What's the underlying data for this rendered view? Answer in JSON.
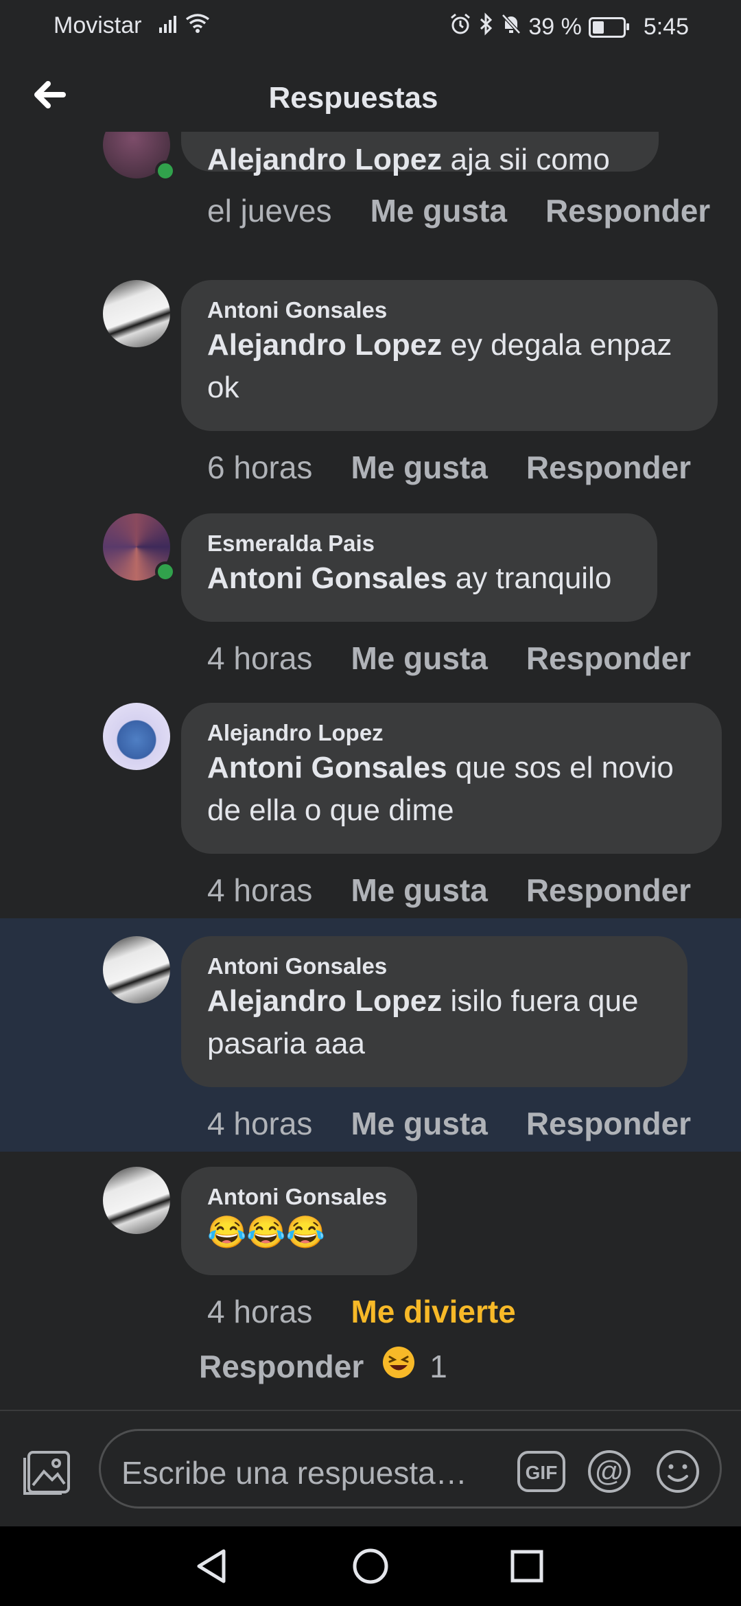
{
  "status": {
    "carrier": "Movistar",
    "battery": "39 %",
    "time": "5:45"
  },
  "header": {
    "title": "Respuestas"
  },
  "comments": [
    {
      "author": "",
      "mention": "Alejandro Lopez",
      "text": "aja sii como",
      "time": "el jueves",
      "like": "Me gusta",
      "reply": "Responder"
    },
    {
      "author": "Antoni Gonsales",
      "mention": "Alejandro Lopez",
      "text": "ey degala enpaz ok",
      "time": "6 horas",
      "like": "Me gusta",
      "reply": "Responder"
    },
    {
      "author": "Esmeralda Pais",
      "mention": "Antoni Gonsales",
      "text": "ay tranquilo",
      "time": "4 horas",
      "like": "Me gusta",
      "reply": "Responder"
    },
    {
      "author": "Alejandro Lopez",
      "mention": "Antoni Gonsales",
      "text": "que sos el novio de ella o que dime",
      "time": "4 horas",
      "like": "Me gusta",
      "reply": "Responder"
    },
    {
      "author": "Antoni Gonsales",
      "mention": "Alejandro Lopez",
      "text": "isilo fuera que pasaria aaa",
      "time": "4 horas",
      "like": "Me gusta",
      "reply": "Responder"
    },
    {
      "author": "Antoni Gonsales",
      "emoji": "😂😂😂",
      "time": "4 horas",
      "reaction": "Me divierte",
      "reply": "Responder",
      "reaction_count": "1"
    }
  ],
  "composer": {
    "placeholder": "Escribe una respuesta…",
    "gif": "GIF"
  },
  "colors": {
    "background": "#242526",
    "bubble": "#3a3b3c",
    "highlight": "#263041",
    "orange": "#f7b928",
    "online": "#31a24c"
  }
}
